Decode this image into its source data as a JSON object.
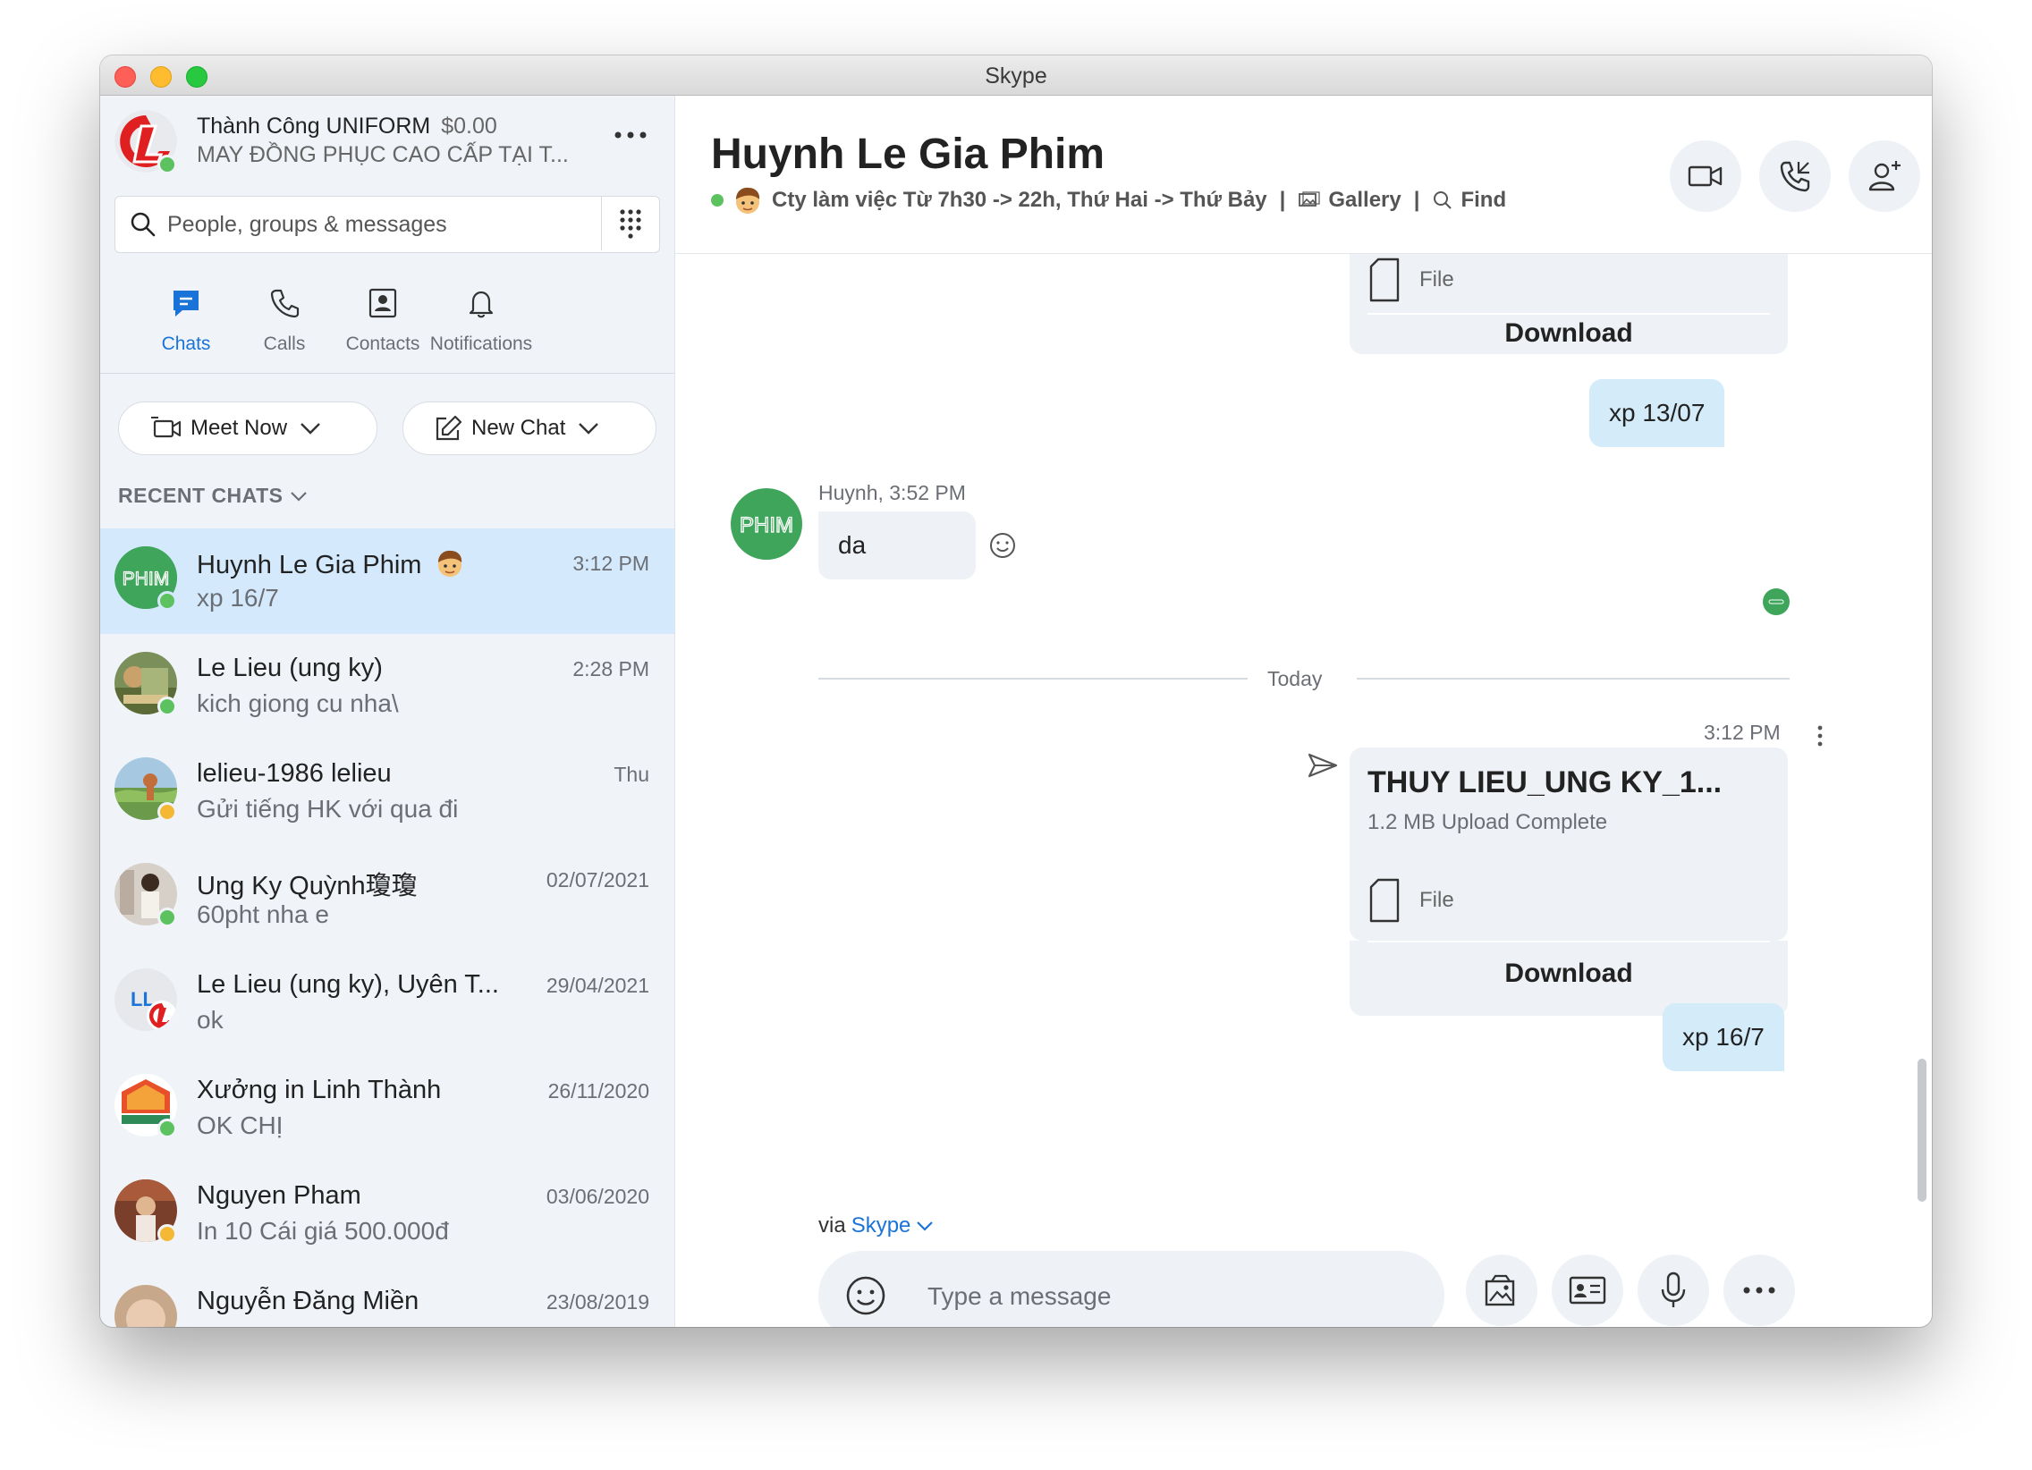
{
  "window": {
    "title": "Skype"
  },
  "profile": {
    "name": "Thành Công UNIFORM",
    "credit": "$0.00",
    "status": "MAY ĐỒNG PHỤC CAO CẤP TẠI T..."
  },
  "search": {
    "placeholder": "People, groups & messages"
  },
  "tabs": [
    {
      "label": "Chats",
      "icon": "chat-icon"
    },
    {
      "label": "Calls",
      "icon": "phone-icon"
    },
    {
      "label": "Contacts",
      "icon": "contacts-icon"
    },
    {
      "label": "Notifications",
      "icon": "bell-icon"
    }
  ],
  "actions": {
    "meet_now": "Meet Now",
    "new_chat": "New Chat"
  },
  "recent_chats_label": "RECENT CHATS",
  "chats": [
    {
      "name": "Huynh Le Gia Phim",
      "preview": "xp 16/7",
      "time": "3:12 PM"
    },
    {
      "name": "Le Lieu (ung ky)",
      "preview": "kich  giong cu nha\\",
      "time": "2:28 PM"
    },
    {
      "name": "lelieu-1986 lelieu",
      "preview": "Gửi tiếng HK với qua đi",
      "time": "Thu"
    },
    {
      "name": "Ung Ky Quỳnh瓊瓊",
      "preview": "60pht nha e",
      "time": "02/07/2021"
    },
    {
      "name": "Le Lieu (ung ky), Uyên T...",
      "preview": "ok",
      "time": "29/04/2021",
      "initials": "LL"
    },
    {
      "name": "Xưởng in Linh Thành",
      "preview": "OK CHỊ",
      "time": "26/11/2020"
    },
    {
      "name": "Nguyen Pham",
      "preview": "In 10 Cái giá 500.000đ",
      "time": "03/06/2020"
    },
    {
      "name": "Nguyễn Đăng Miền",
      "preview": "",
      "time": "23/08/2019"
    }
  ],
  "conversation": {
    "title": "Huynh Le Gia Phim",
    "mood": "Cty làm việc Từ 7h30 -> 22h, Thứ Hai -> Thứ Bảy",
    "gallery": "Gallery",
    "find": "Find",
    "separator": "|",
    "avatar_text": "PHIM",
    "messages": {
      "file1_label": "File",
      "file1_download": "Download",
      "bubble1": "xp 13/07",
      "incoming_sender_time": "Huynh, 3:52 PM",
      "incoming_text": "da",
      "date_divider": "Today",
      "file2_time": "3:12 PM",
      "file2_name": "THUY LIEU_UNG KY_1...",
      "file2_status": "1.2 MB Upload Complete",
      "file2_label": "File",
      "file2_download": "Download",
      "bubble2": "xp 16/7"
    }
  },
  "composer": {
    "via_prefix": "via",
    "via_link": "Skype",
    "placeholder": "Type a message"
  },
  "colors": {
    "accent": "#1a73d9",
    "presence_online": "#5cc25f",
    "presence_away": "#f5b835",
    "active_chat_bg": "#d4eafc",
    "outgoing_bubble": "#d4ecfa",
    "avatar_green": "#3ea55a"
  }
}
